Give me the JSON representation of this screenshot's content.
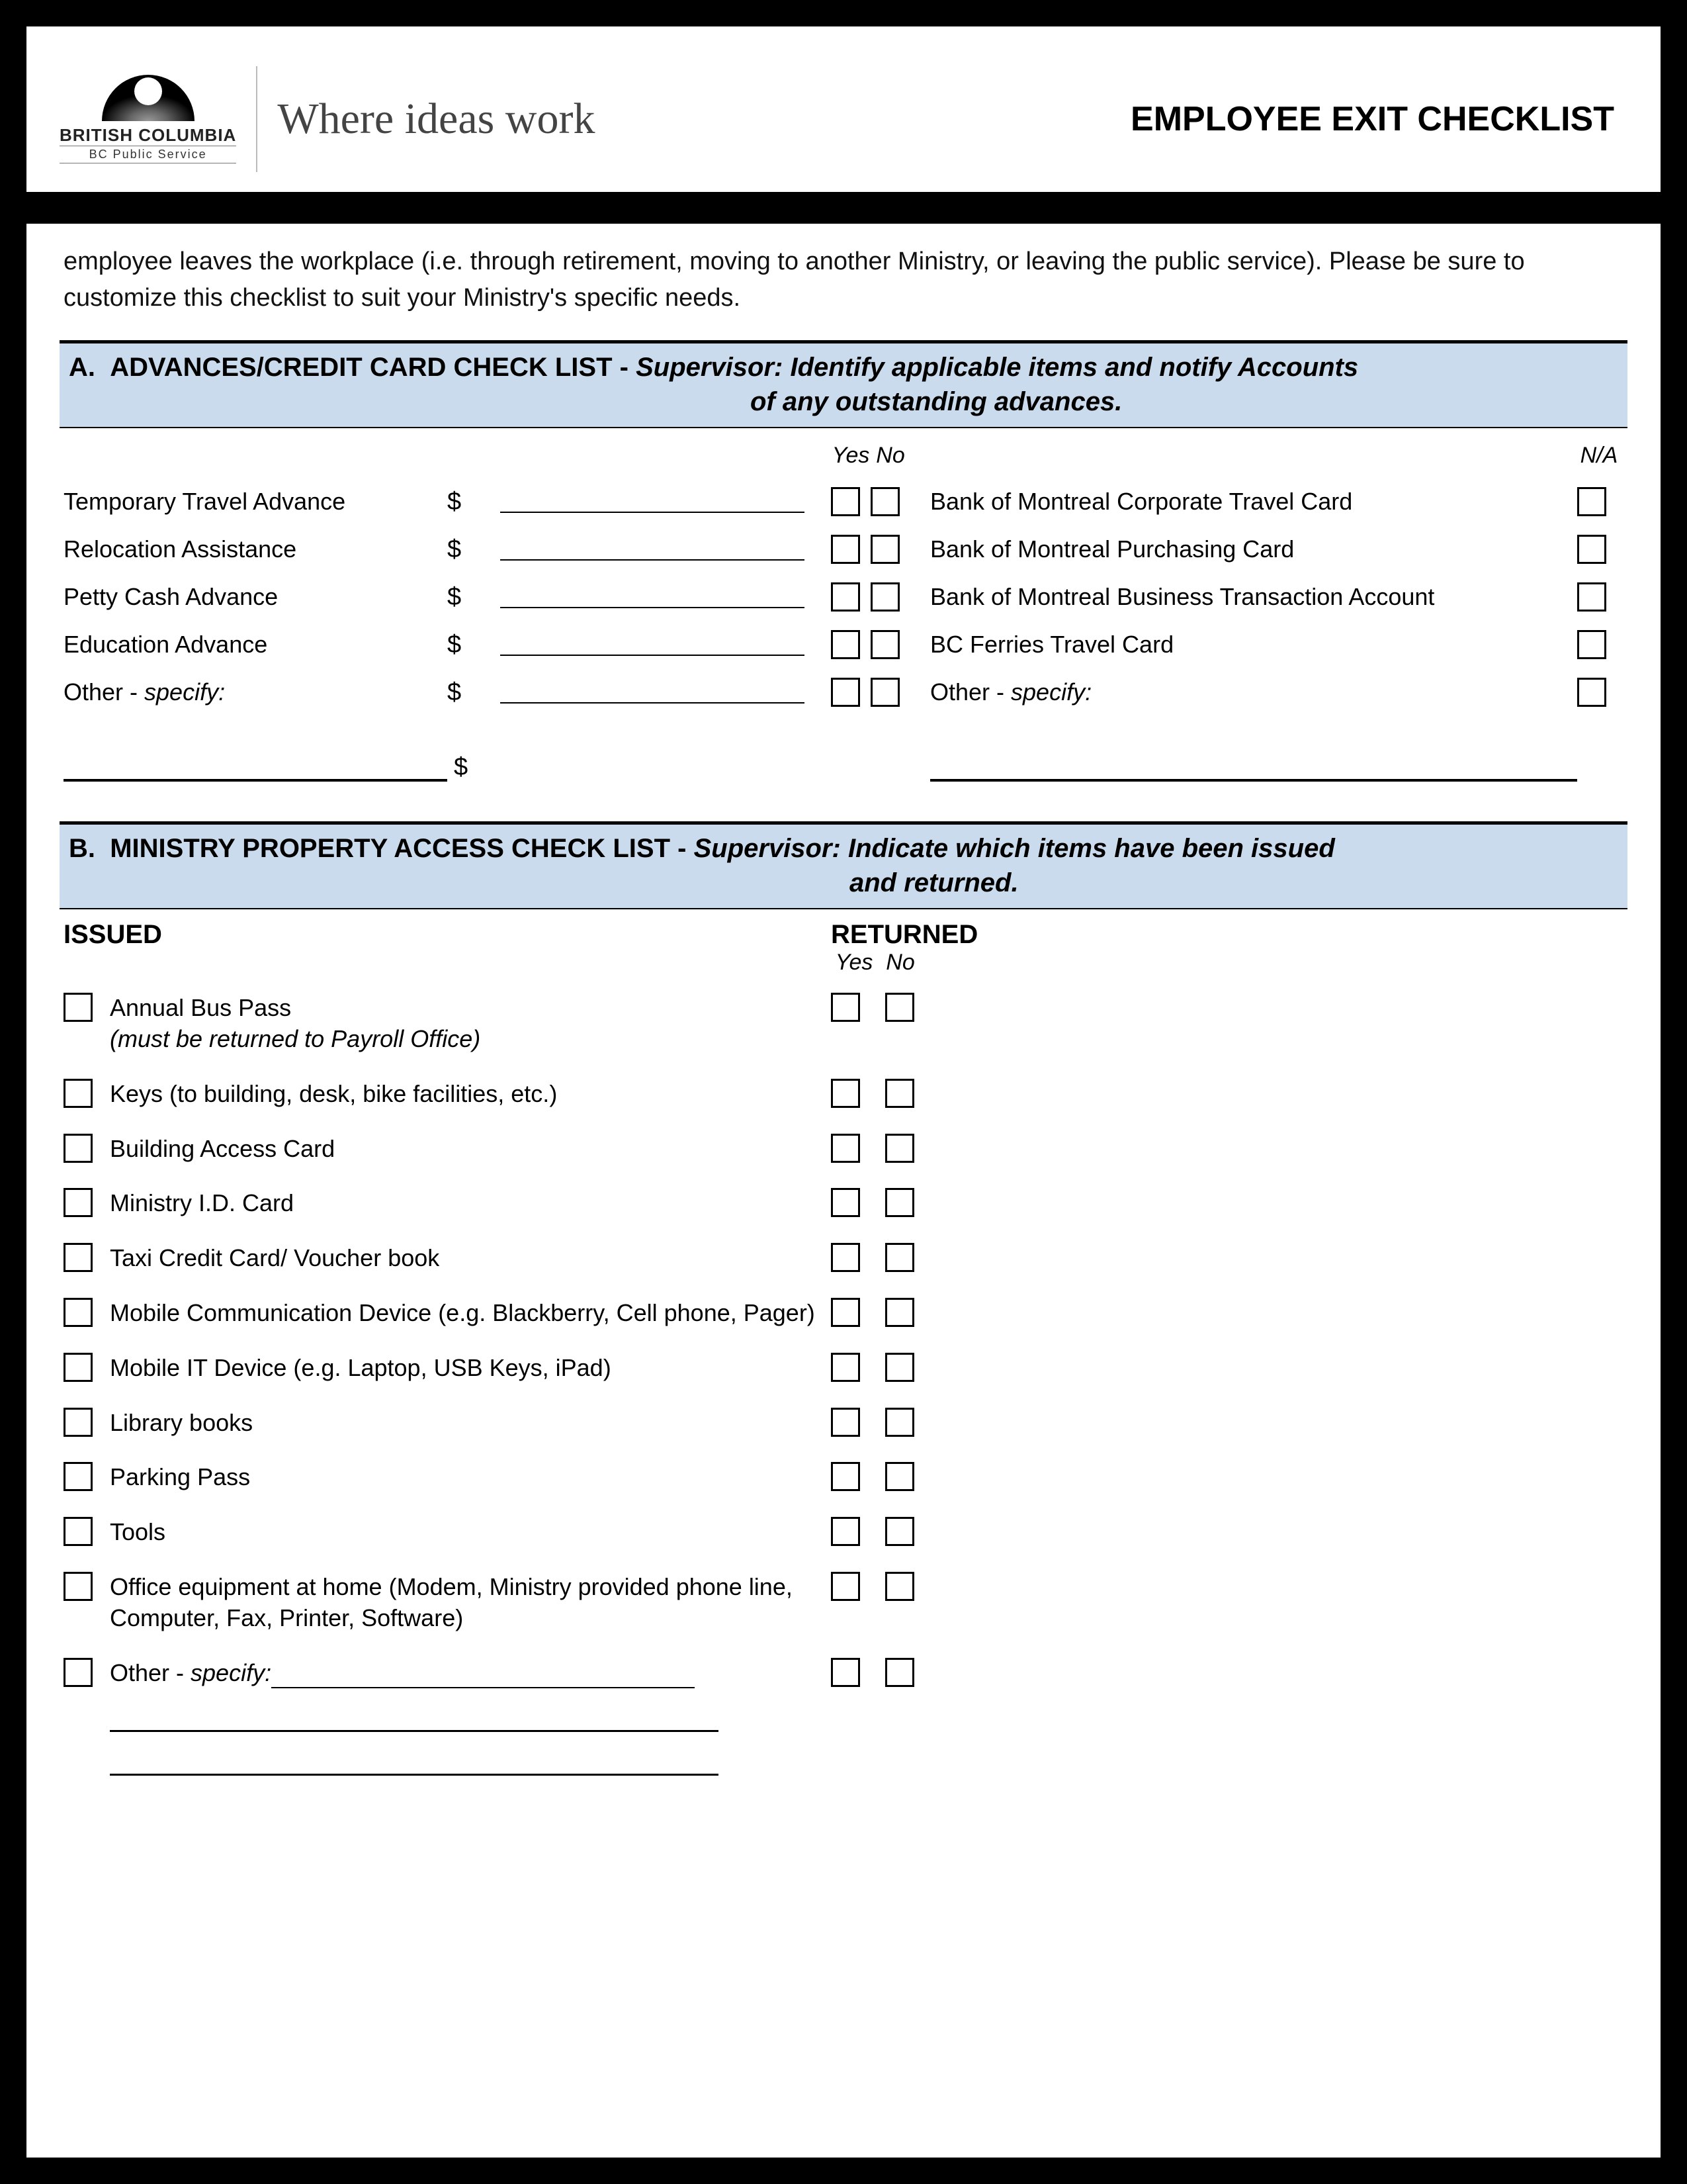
{
  "logo": {
    "line1": "BRITISH",
    "line2": "COLUMBIA",
    "line3": "BC Public Service"
  },
  "tagline": "Where ideas work",
  "title": "EMPLOYEE EXIT CHECKLIST",
  "intro": "employee leaves the workplace (i.e. through retirement, moving to another Ministry, or leaving the public service).  Please be sure to customize this checklist to suit your Ministry's specific needs.",
  "sectionA": {
    "letter": "A.",
    "title": "ADVANCES/CREDIT CARD CHECK LIST -",
    "instruction_line1": "Supervisor:  Identify applicable items and notify Accounts",
    "instruction_line2": "of any outstanding advances.",
    "col_yes": "Yes",
    "col_no": "No",
    "col_na": "N/A",
    "currency": "$",
    "left_items": [
      "Temporary Travel Advance",
      "Relocation Assistance",
      "Petty Cash Advance",
      "Education Advance"
    ],
    "other_label": "Other - ",
    "specify": "specify:",
    "right_items": [
      "Bank of Montreal Corporate Travel Card",
      "Bank of Montreal Purchasing Card",
      "Bank of Montreal Business Transaction Account",
      "BC Ferries Travel Card"
    ]
  },
  "sectionB": {
    "letter": "B.",
    "title": "MINISTRY PROPERTY ACCESS CHECK LIST -",
    "instruction_line1": "Supervisor:  Indicate which items have been issued",
    "instruction_line2": "and returned.",
    "issued": "ISSUED",
    "returned": "RETURNED",
    "col_yes": "Yes",
    "col_no": "No",
    "items": [
      {
        "text": "Annual Bus Pass",
        "sub": "(must be returned to Payroll Office)"
      },
      {
        "text": "Keys (to building, desk, bike facilities, etc.)"
      },
      {
        "text": "Building Access Card"
      },
      {
        "text": "Ministry I.D. Card"
      },
      {
        "text": "Taxi Credit Card/ Voucher book"
      },
      {
        "text": "Mobile Communication Device (e.g. Blackberry, Cell phone, Pager)"
      },
      {
        "text": "Mobile IT Device (e.g. Laptop, USB Keys, iPad)"
      },
      {
        "text": "Library books"
      },
      {
        "text": "Parking Pass"
      },
      {
        "text": "Tools"
      },
      {
        "text": "Office equipment at home (Modem, Ministry provided phone line, Computer, Fax, Printer, Software)"
      }
    ],
    "other_label": "Other - ",
    "specify": "specify:"
  }
}
